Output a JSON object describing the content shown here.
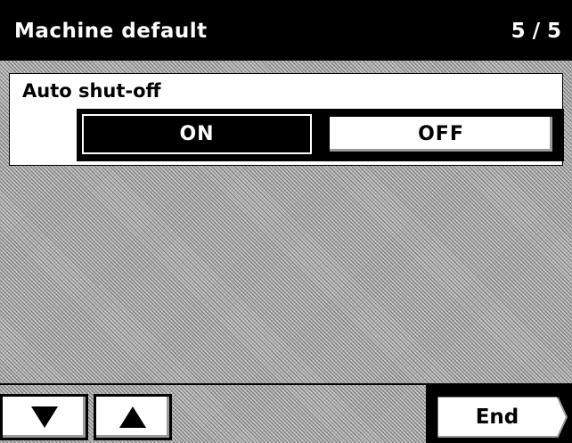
{
  "header": {
    "title": "Machine default",
    "page_indicator": "5 / 5"
  },
  "setting": {
    "label": "Auto shut-off",
    "options": [
      {
        "label": "ON",
        "selected": true
      },
      {
        "label": "OFF",
        "selected": false
      }
    ]
  },
  "navigation": {
    "down_icon": "triangle-down-icon",
    "up_icon": "triangle-up-icon",
    "end_label": "End"
  },
  "colors": {
    "title_bar": "#000000",
    "background_pattern": "#b4b4b4",
    "selected_button": "#000000",
    "unselected_button": "#ffffff"
  }
}
